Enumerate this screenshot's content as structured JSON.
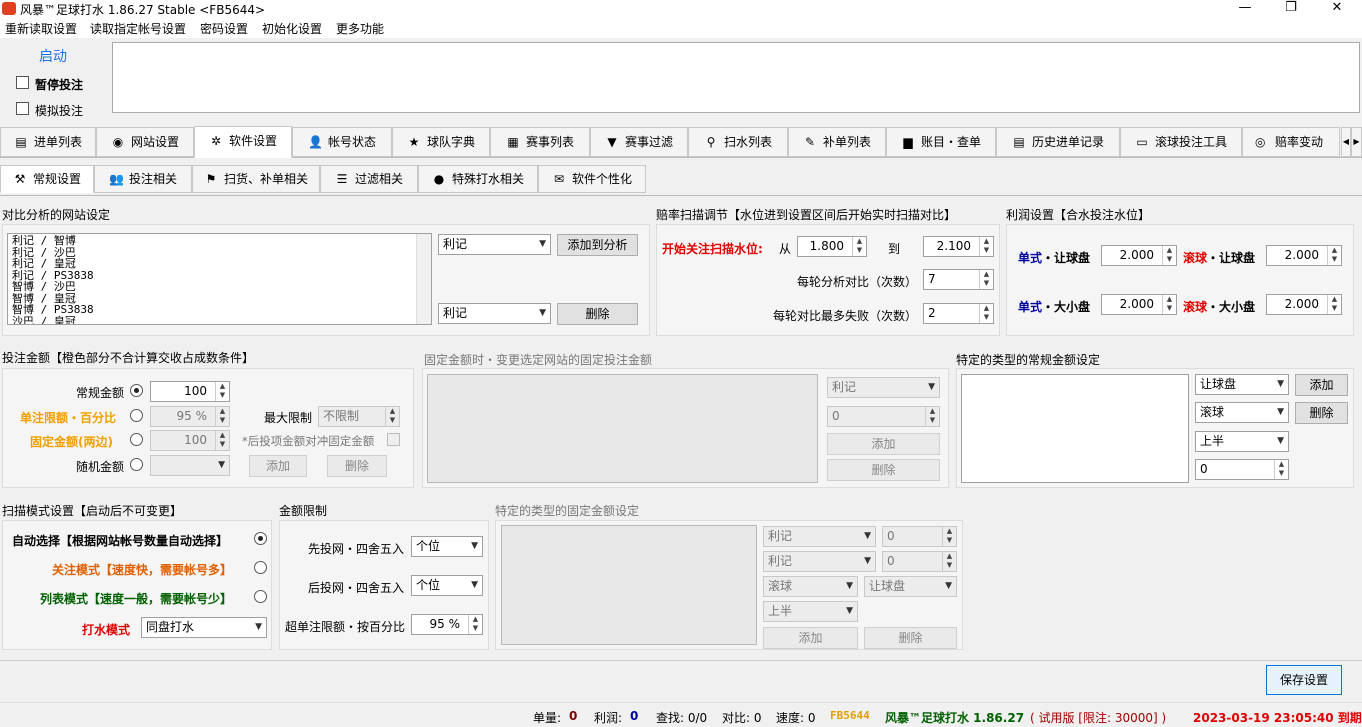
{
  "window": {
    "title": "风暴™足球打水 1.86.27 Stable <FB5644>",
    "min": "—",
    "max": "❐",
    "close": "✕"
  },
  "menu": [
    "重新读取设置",
    "读取指定帐号设置",
    "密码设置",
    "初始化设置",
    "更多功能"
  ],
  "start": {
    "label": "启动",
    "pause": "暂停投注",
    "simulate": "模拟投注"
  },
  "main_tabs": [
    "进单列表",
    "网站设置",
    "软件设置",
    "帐号状态",
    "球队字典",
    "赛事列表",
    "赛事过滤",
    "扫水列表",
    "补单列表",
    "账目・查单",
    "历史进单记录",
    "滚球投注工具",
    "赔率变动"
  ],
  "sub_tabs": [
    "常规设置",
    "投注相关",
    "扫货、补单相关",
    "过滤相关",
    "特殊打水相关",
    "软件个性化"
  ],
  "compare": {
    "title": "对比分析的网站设定",
    "list": [
      "利记 / 智博",
      "利记 / 沙巴",
      "利记 / 皇冠",
      "利记 / PS3838",
      "智博 / 沙巴",
      "智博 / 皇冠",
      "智博 / PS3838",
      "沙巴 / 皇冠"
    ],
    "site1": "利记",
    "site2": "利记",
    "add": "添加到分析",
    "del": "删除"
  },
  "scan": {
    "title": "赔率扫描调节【水位进到设置区间后开始实时扫描对比】",
    "start_label": "开始关注扫描水位:",
    "from": "从",
    "from_val": "1.800",
    "to": "到",
    "to_val": "2.100",
    "rounds_label": "每轮分析对比（次数）",
    "rounds": "7",
    "fails_label": "每轮对比最多失败（次数）",
    "fails": "2"
  },
  "profit": {
    "title": "利润设置【合水投注水位】",
    "single": "单式",
    "rolling": "滚球",
    "rang": "・让球盘",
    "daxiao": "・大小盘",
    "v1": "2.000",
    "v2": "2.000",
    "v3": "2.000",
    "v4": "2.000"
  },
  "bet": {
    "title": "投注金额【橙色部分不合计算交收占成数条件】",
    "normal": "常规金额",
    "normal_val": "100",
    "single_pct": "单注限额・百分比",
    "pct_val": "95 %",
    "max_label": "最大限制",
    "max_val": "不限制",
    "fixed": "固定金额(两边)",
    "fixed_val": "100",
    "note": "*后投项金额对冲固定金额",
    "random": "随机金额",
    "add": "添加",
    "del": "删除"
  },
  "fixed_site": {
    "title": "固定金额时・变更选定网站的固定投注金额",
    "site": "利记",
    "val": "0",
    "add": "添加",
    "del": "删除"
  },
  "type_normal": {
    "title": "特定的类型的常规金额设定",
    "s1": "让球盘",
    "s2": "滚球",
    "s3": "上半",
    "val": "0",
    "add": "添加",
    "del": "删除"
  },
  "scan_mode": {
    "title": "扫描模式设置【启动后不可变更】",
    "auto": "自动选择【根据网站帐号数量自动选择】",
    "focus": "关注模式【速度快，需要帐号多】",
    "list": "列表模式【速度一般，需要帐号少】",
    "water": "打水模式",
    "water_val": "同盘打水"
  },
  "limit": {
    "title": "金额限制",
    "first": "先投网・四舍五入",
    "first_val": "个位",
    "after": "后投网・四舍五入",
    "after_val": "个位",
    "over": "超单注限额・按百分比",
    "over_val": "95 %"
  },
  "type_fixed": {
    "title": "特定的类型的固定金额设定",
    "a": "利记",
    "b": "利记",
    "c": "滚球",
    "d": "让球盘",
    "e": "上半",
    "v": "0",
    "add": "添加",
    "del": "删除"
  },
  "save": "保存设置",
  "status": {
    "dan": "单量:",
    "dan_v": "0",
    "lirun": "利润:",
    "lirun_v": "0",
    "find": "查找: 0/0",
    "dui": "对比: 0",
    "speed": "速度: 0",
    "code": "FB5644",
    "name": "风暴™足球打水 1.86.27",
    "trial": "( 试用版 [限注: 30000] )",
    "expire": "2023-03-19 23:05:40 到期"
  }
}
